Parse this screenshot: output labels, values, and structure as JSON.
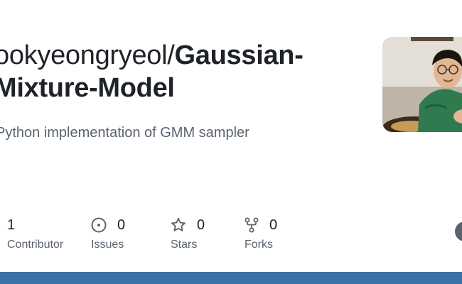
{
  "repo": {
    "owner": "ookyeongryeol/",
    "name": "Gaussian-Mixture-Model",
    "description": "Python implementation of GMM sampler"
  },
  "stats": [
    {
      "key": "contributors",
      "value": "1",
      "label": "Contributor",
      "icon": "people-icon"
    },
    {
      "key": "issues",
      "value": "0",
      "label": "Issues",
      "icon": "issue-opened-icon"
    },
    {
      "key": "stars",
      "value": "0",
      "label": "Stars",
      "icon": "star-icon"
    },
    {
      "key": "forks",
      "value": "0",
      "label": "Forks",
      "icon": "repo-forked-icon"
    }
  ],
  "colors": {
    "title": "#1f2328",
    "muted": "#59636e",
    "bottom_bar": "#3b73a8"
  }
}
